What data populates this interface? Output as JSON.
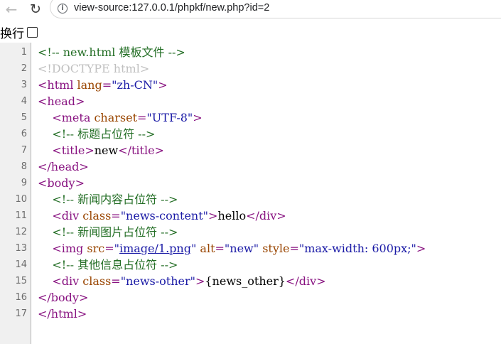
{
  "browser": {
    "url": "view-source:127.0.0.1/phpkf/new.php?id=2",
    "back_icon": "←",
    "reload_icon": "↻"
  },
  "wrap_toggle": {
    "label": "换行",
    "checked": false
  },
  "colors": {
    "tag": "#881280",
    "attribute": "#994500",
    "value": "#1a1aa6",
    "comment": "#236e25",
    "doctype": "#c0c0c0"
  },
  "source_lines": [
    {
      "n": "1",
      "t": [
        [
          "comment",
          "<!-- new.html 模板文件 -->"
        ]
      ]
    },
    {
      "n": "2",
      "t": [
        [
          "doctype",
          "<!DOCTYPE html>"
        ]
      ]
    },
    {
      "n": "3",
      "t": [
        [
          "tag",
          "<html "
        ],
        [
          "attr",
          "lang"
        ],
        [
          "tag",
          "="
        ],
        [
          "val",
          "\"zh-CN\""
        ],
        [
          "tag",
          ">"
        ]
      ]
    },
    {
      "n": "4",
      "t": [
        [
          "tag",
          "<head>"
        ]
      ]
    },
    {
      "n": "5",
      "t": [
        [
          "text",
          "    "
        ],
        [
          "tag",
          "<meta "
        ],
        [
          "attr",
          "charset"
        ],
        [
          "tag",
          "="
        ],
        [
          "val",
          "\"UTF-8\""
        ],
        [
          "tag",
          ">"
        ]
      ]
    },
    {
      "n": "6",
      "t": [
        [
          "text",
          "    "
        ],
        [
          "comment",
          "<!-- 标题占位符 -->"
        ]
      ]
    },
    {
      "n": "7",
      "t": [
        [
          "text",
          "    "
        ],
        [
          "tag",
          "<title>"
        ],
        [
          "text",
          "new"
        ],
        [
          "tag",
          "</title>"
        ]
      ]
    },
    {
      "n": "8",
      "t": [
        [
          "tag",
          "</head>"
        ]
      ]
    },
    {
      "n": "9",
      "t": [
        [
          "tag",
          "<body>"
        ]
      ]
    },
    {
      "n": "10",
      "t": [
        [
          "text",
          "    "
        ],
        [
          "comment",
          "<!-- 新闻内容占位符 -->"
        ]
      ]
    },
    {
      "n": "11",
      "t": [
        [
          "text",
          "    "
        ],
        [
          "tag",
          "<div "
        ],
        [
          "attr",
          "class"
        ],
        [
          "tag",
          "="
        ],
        [
          "val",
          "\"news-content\""
        ],
        [
          "tag",
          ">"
        ],
        [
          "text",
          "hello"
        ],
        [
          "tag",
          "</div>"
        ]
      ]
    },
    {
      "n": "12",
      "t": [
        [
          "text",
          "    "
        ],
        [
          "comment",
          "<!-- 新闻图片占位符 -->"
        ]
      ]
    },
    {
      "n": "13",
      "t": [
        [
          "text",
          "    "
        ],
        [
          "tag",
          "<img "
        ],
        [
          "attr",
          "src"
        ],
        [
          "tag",
          "="
        ],
        [
          "val",
          "\""
        ],
        [
          "link",
          "image/1.png"
        ],
        [
          "val",
          "\""
        ],
        [
          "tag",
          " "
        ],
        [
          "attr",
          "alt"
        ],
        [
          "tag",
          "="
        ],
        [
          "val",
          "\"new\""
        ],
        [
          "tag",
          " "
        ],
        [
          "attr",
          "style"
        ],
        [
          "tag",
          "="
        ],
        [
          "val",
          "\"max-width: 600px;\""
        ],
        [
          "tag",
          ">"
        ]
      ]
    },
    {
      "n": "14",
      "t": [
        [
          "text",
          "    "
        ],
        [
          "comment",
          "<!-- 其他信息占位符 -->"
        ]
      ]
    },
    {
      "n": "15",
      "t": [
        [
          "text",
          "    "
        ],
        [
          "tag",
          "<div "
        ],
        [
          "attr",
          "class"
        ],
        [
          "tag",
          "="
        ],
        [
          "val",
          "\"news-other\""
        ],
        [
          "tag",
          ">"
        ],
        [
          "text",
          "{news_other}"
        ],
        [
          "tag",
          "</div>"
        ]
      ]
    },
    {
      "n": "16",
      "t": [
        [
          "tag",
          "</body>"
        ]
      ]
    },
    {
      "n": "17",
      "t": [
        [
          "tag",
          "</html>"
        ]
      ]
    }
  ]
}
